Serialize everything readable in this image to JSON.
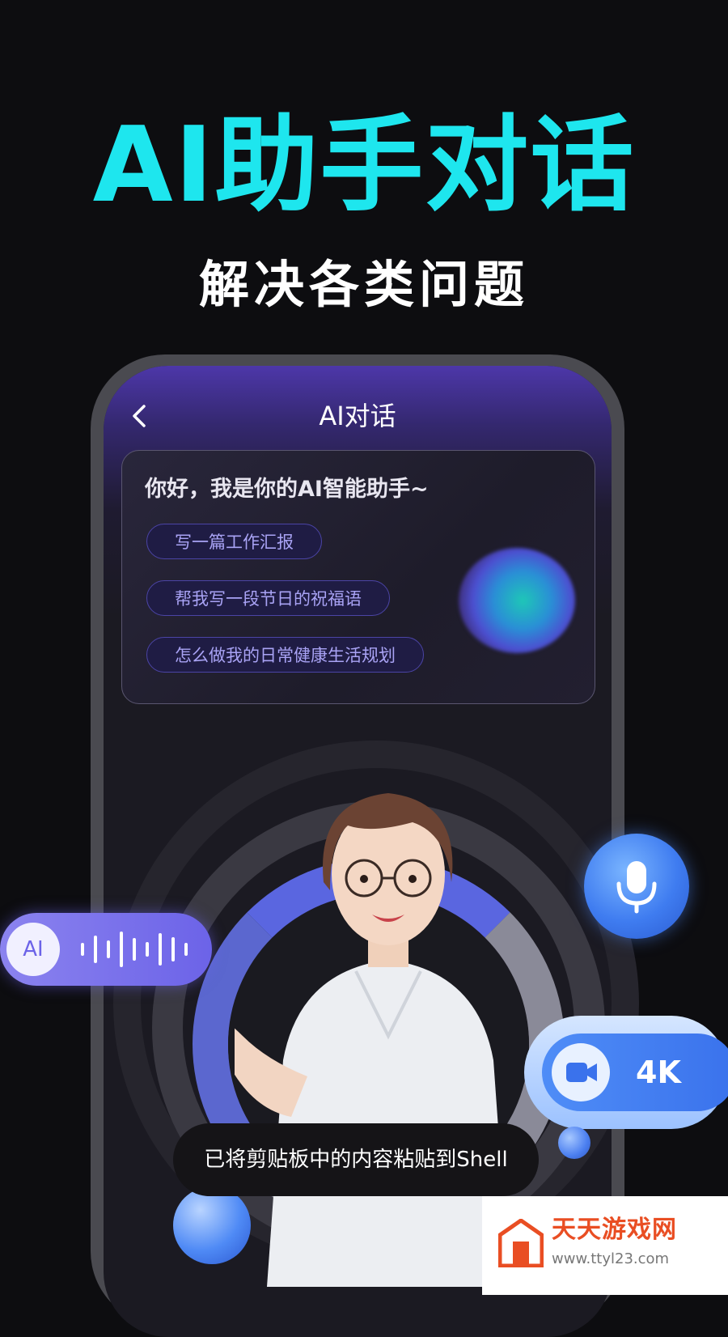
{
  "headline": "AI助手对话",
  "subhead": "解决各类问题",
  "app": {
    "title": "AI对话",
    "back_icon": "chevron-left-icon"
  },
  "card": {
    "greeting": "你好，我是你的AI智能助手~",
    "suggestions": [
      "写一篇工作汇报",
      "帮我写一段节日的祝福语",
      "怎么做我的日常健康生活规划"
    ]
  },
  "voice_pill": {
    "ai_label": "AI",
    "icon": "waveform-icon"
  },
  "mic_button": {
    "icon": "microphone-icon"
  },
  "video_button": {
    "label": "4K",
    "icon": "video-camera-icon"
  },
  "toast": {
    "text": "已将剪贴板中的内容粘贴到Shell"
  },
  "watermark": {
    "title": "天天游戏网",
    "url": "www.ttyl23.com"
  },
  "colors": {
    "headline": "#1ee6ee",
    "accent_purple": "#6c63e8",
    "accent_blue": "#3f7cf0",
    "background": "#0d0d10"
  }
}
